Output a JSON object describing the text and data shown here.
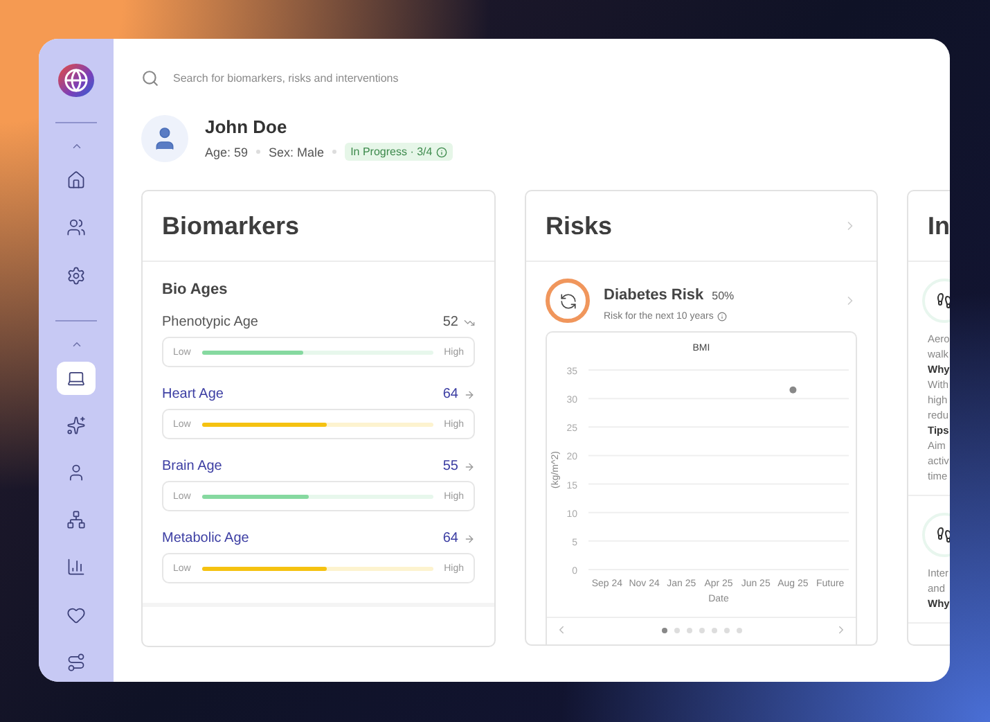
{
  "sidebar": {
    "top_items": [
      {
        "selected": false
      },
      {
        "selected": false
      },
      {
        "selected": false
      }
    ],
    "bottom_items": [
      {
        "selected": true
      },
      {
        "selected": false
      },
      {
        "selected": false
      },
      {
        "selected": false
      },
      {
        "selected": false
      },
      {
        "selected": false
      },
      {
        "selected": false
      }
    ]
  },
  "search": {
    "placeholder": "Search for biomarkers, risks and interventions"
  },
  "profile": {
    "name": "John Doe",
    "age": "Age: 59",
    "sex": "Sex: Male",
    "status": "In Progress · 3/4"
  },
  "biomarkers": {
    "title": "Biomarkers",
    "section": "Bio Ages",
    "rows": [
      {
        "name": "Phenotypic Age",
        "kind": "plain",
        "value": "52",
        "low": "Low",
        "high": "High",
        "level": 0.44,
        "color": "#86d9a0"
      },
      {
        "name": "Heart Age",
        "kind": "link",
        "value": "64",
        "low": "Low",
        "high": "High",
        "level": 0.54,
        "color": "#f5c211"
      },
      {
        "name": "Brain Age",
        "kind": "link",
        "value": "55",
        "low": "Low",
        "high": "High",
        "level": 0.46,
        "color": "#86d9a0"
      },
      {
        "name": "Metabolic Age",
        "kind": "link",
        "value": "64",
        "low": "Low",
        "high": "High",
        "level": 0.54,
        "color": "#f5c211"
      }
    ]
  },
  "risks": {
    "title": "Risks",
    "risk": {
      "name": "Diabetes Risk",
      "percent": "50%",
      "subtitle": "Risk for the next 10 years"
    },
    "chart_data": {
      "type": "scatter",
      "title": "BMI",
      "xlabel": "Date",
      "ylabel": "(kg/m^2)",
      "categories": [
        "Sep 24",
        "Nov 24",
        "Jan 25",
        "Apr 25",
        "Jun 25",
        "Aug 25",
        "Future"
      ],
      "grid": true,
      "series": [
        {
          "color": "#888888",
          "values": [
            null,
            null,
            null,
            null,
            null,
            31.5,
            null
          ]
        }
      ],
      "ylim": [
        0,
        35
      ],
      "yticks": [
        0,
        5,
        10,
        15,
        20,
        25,
        30,
        35
      ]
    },
    "pager": [
      {
        "selected": true
      },
      {
        "selected": false
      },
      {
        "selected": false
      },
      {
        "selected": false
      },
      {
        "selected": false
      },
      {
        "selected": false
      },
      {
        "selected": false
      }
    ]
  },
  "interventions": {
    "title": "In",
    "items": [
      {
        "lines": [
          {
            "text": "Aero",
            "kind": "body"
          },
          {
            "text": "walk",
            "kind": "body"
          },
          {
            "text": "Why",
            "kind": "heading"
          },
          {
            "text": "With",
            "kind": "body"
          },
          {
            "text": "high",
            "kind": "body"
          },
          {
            "text": "redu",
            "kind": "body"
          },
          {
            "text": "Tips",
            "kind": "heading"
          },
          {
            "text": "Aim",
            "kind": "body"
          },
          {
            "text": "activ",
            "kind": "body"
          },
          {
            "text": "time",
            "kind": "body"
          }
        ]
      },
      {
        "lines": [
          {
            "text": "Inter",
            "kind": "body"
          },
          {
            "text": "and",
            "kind": "body"
          },
          {
            "text": "Why",
            "kind": "heading"
          }
        ]
      }
    ]
  }
}
